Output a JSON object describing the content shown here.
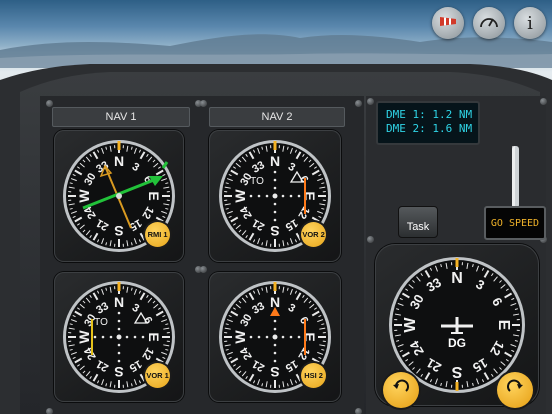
{
  "toolbar": {
    "items": [
      {
        "name": "windsock-icon"
      },
      {
        "name": "gauge-icon"
      },
      {
        "name": "info-icon",
        "glyph": "i"
      }
    ]
  },
  "nav_labels": [
    "NAV 1",
    "NAV 2"
  ],
  "dme": {
    "line1": "DME 1: 1.2 NM",
    "line2": "DME 2: 1.6 NM"
  },
  "task_label": "Task",
  "go_speed_label": "GO SPEED",
  "instruments": [
    {
      "badge": "RMI 1"
    },
    {
      "badge": "VOR 2",
      "flag": "TO"
    },
    {
      "badge": "VOR 1",
      "flag": "TO"
    },
    {
      "badge": "HSI 2"
    },
    {
      "label": "DG"
    }
  ],
  "compass_labels": {
    "N": "N",
    "E": "E",
    "S": "S",
    "W": "W",
    "numbers": [
      "3",
      "6",
      "12",
      "15",
      "21",
      "24",
      "30",
      "33"
    ]
  },
  "colors": {
    "accent": "#f5b324",
    "needle_green": "#22c23a",
    "dme_text": "#2fd4e6",
    "cdi_orange": "#ff7a1a",
    "go_text": "#f0b32a"
  }
}
